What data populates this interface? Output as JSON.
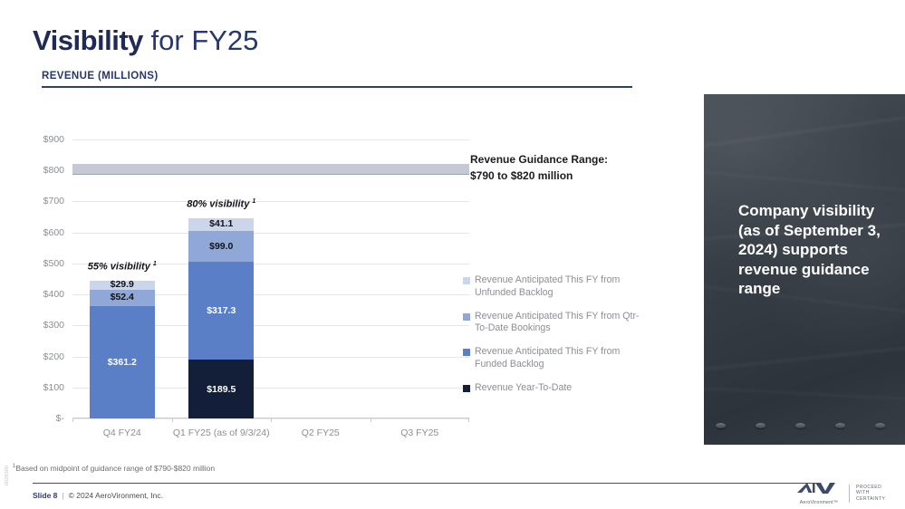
{
  "slide": {
    "title_strong": "Visibility",
    "title_rest": " for FY25",
    "section_label": "REVENUE (MILLIONS)",
    "footnote": "Based on midpoint of guidance range of $790-$820 million",
    "footnote_marker": "1",
    "footer_slide": "Slide 8",
    "footer_separator": "|",
    "footer_copyright": "© 2024 AeroVironment, Inc.",
    "doc_code": "0026000"
  },
  "guidance_callout": {
    "line1": "Revenue Guidance Range:",
    "line2": "$790 to $820 million"
  },
  "photo_panel": {
    "text": "Company visibility (as of September 3, 2024) supports revenue guidance range"
  },
  "logo": {
    "name": "AeroVironment™",
    "tagline_line1": "PROCEED",
    "tagline_line2": "WITH",
    "tagline_line3": "CERTAINTY"
  },
  "legend": {
    "items": [
      {
        "label": "Revenue Anticipated This FY from Unfunded Backlog",
        "color": "#ccd6eb"
      },
      {
        "label": "Revenue Anticipated This FY from Qtr-To-Date Bookings",
        "color": "#8fa8d8"
      },
      {
        "label": "Revenue Anticipated This FY from Funded Backlog",
        "color": "#5b7fc7"
      },
      {
        "label": "Revenue Year-To-Date",
        "color": "#131f38"
      }
    ]
  },
  "chart_data": {
    "type": "bar",
    "subtype": "stacked-column",
    "title": "REVENUE (MILLIONS)",
    "xlabel": "",
    "ylabel": "",
    "categories": [
      "Q4 FY24",
      "Q1 FY25 (as of 9/3/24)",
      "Q2 FY25",
      "Q3 FY25"
    ],
    "ylim": [
      0,
      900
    ],
    "yticks": [
      0,
      100,
      200,
      300,
      400,
      500,
      600,
      700,
      800,
      900
    ],
    "ytick_labels": [
      "$-",
      "$100",
      "$200",
      "$300",
      "$400",
      "$500",
      "$600",
      "$700",
      "$800",
      "$900"
    ],
    "grid": true,
    "legend_position": "right",
    "series": [
      {
        "name": "Revenue Year-To-Date",
        "color": "#131f38",
        "values": [
          0,
          189.5,
          null,
          null
        ],
        "labels": [
          "",
          "$189.5",
          "",
          ""
        ]
      },
      {
        "name": "Revenue Anticipated This FY from Funded Backlog",
        "color": "#5b7fc7",
        "values": [
          361.2,
          317.3,
          null,
          null
        ],
        "labels": [
          "$361.2",
          "$317.3",
          "",
          ""
        ]
      },
      {
        "name": "Revenue Anticipated This FY from Qtr-To-Date Bookings",
        "color": "#8fa8d8",
        "values": [
          52.4,
          99.0,
          null,
          null
        ],
        "labels": [
          "$52.4",
          "$99.0",
          "",
          ""
        ]
      },
      {
        "name": "Revenue Anticipated This FY from Unfunded Backlog",
        "color": "#ccd6eb",
        "values": [
          29.9,
          41.1,
          null,
          null
        ],
        "labels": [
          "$29.9",
          "$41.1",
          "",
          ""
        ]
      }
    ],
    "totals": [
      443.5,
      646.9,
      null,
      null
    ],
    "annotations": [
      {
        "category": "Q4 FY24",
        "text": "55% visibility",
        "marker": "1",
        "value": 443.5
      },
      {
        "category": "Q1 FY25 (as of 9/3/24)",
        "text": "80% visibility",
        "marker": "1",
        "value": 646.9
      }
    ],
    "guidance_band": {
      "label": "Revenue Guidance Range",
      "low": 790,
      "high": 820,
      "color": "#c4c9d5"
    }
  }
}
